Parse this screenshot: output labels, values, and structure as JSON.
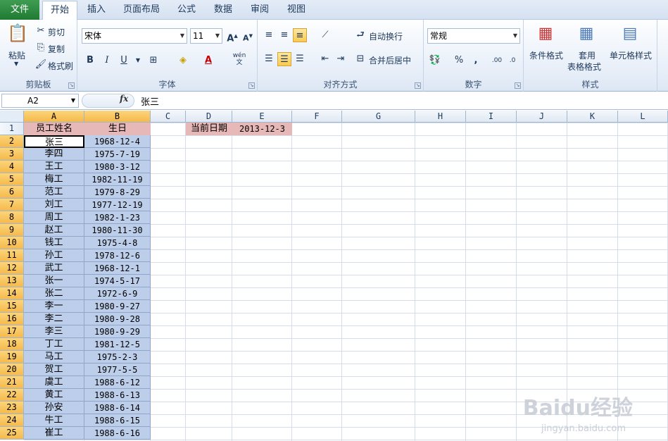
{
  "tabs": [
    "文件",
    "开始",
    "插入",
    "页面布局",
    "公式",
    "数据",
    "审阅",
    "视图"
  ],
  "clipboard": {
    "paste": "粘贴",
    "cut": "剪切",
    "copy": "复制",
    "format_painter": "格式刷",
    "label": "剪贴板"
  },
  "font": {
    "name": "宋体",
    "size": "11",
    "label": "字体",
    "bold": "B",
    "italic": "I",
    "underline": "U",
    "phonetic": "wén"
  },
  "alignment": {
    "wrap": "自动换行",
    "merge": "合并后居中",
    "label": "对齐方式"
  },
  "number": {
    "format": "常规",
    "percent": "%",
    "comma": ",",
    "label": "数字"
  },
  "styles": {
    "conditional": "条件格式",
    "table_line1": "套用",
    "table_line2": "表格格式",
    "cell_styles": "单元格样式",
    "label": "样式"
  },
  "formula_bar": {
    "name_box": "A2",
    "fx": "fx",
    "content": "张三"
  },
  "columns": [
    "A",
    "B",
    "C",
    "D",
    "E",
    "F",
    "G",
    "H",
    "I",
    "J",
    "K",
    "L"
  ],
  "rows": [
    "1",
    "2",
    "3",
    "4",
    "5",
    "6",
    "7",
    "8",
    "9",
    "10",
    "11",
    "12",
    "13",
    "14",
    "15",
    "16",
    "17",
    "18",
    "19",
    "20",
    "21",
    "22",
    "23",
    "24",
    "25"
  ],
  "sheet": {
    "header_name": "员工姓名",
    "header_birth": "生日",
    "current_date_label": "当前日期",
    "current_date_value": "2013-12-3",
    "employees": [
      {
        "name": "张三",
        "birth": "1968-12-4"
      },
      {
        "name": "李四",
        "birth": "1975-7-19"
      },
      {
        "name": "王工",
        "birth": "1980-3-12"
      },
      {
        "name": "梅工",
        "birth": "1982-11-19"
      },
      {
        "name": "范工",
        "birth": "1979-8-29"
      },
      {
        "name": "刘工",
        "birth": "1977-12-19"
      },
      {
        "name": "周工",
        "birth": "1982-1-23"
      },
      {
        "name": "赵工",
        "birth": "1980-11-30"
      },
      {
        "name": "钱工",
        "birth": "1975-4-8"
      },
      {
        "name": "孙工",
        "birth": "1978-12-6"
      },
      {
        "name": "武工",
        "birth": "1968-12-1"
      },
      {
        "name": "张一",
        "birth": "1974-5-17"
      },
      {
        "name": "张二",
        "birth": "1972-6-9"
      },
      {
        "name": "李一",
        "birth": "1980-9-27"
      },
      {
        "name": "李二",
        "birth": "1980-9-28"
      },
      {
        "name": "李三",
        "birth": "1980-9-29"
      },
      {
        "name": "丁工",
        "birth": "1981-12-5"
      },
      {
        "name": "马工",
        "birth": "1975-2-3"
      },
      {
        "name": "贺工",
        "birth": "1977-5-5"
      },
      {
        "name": "虞工",
        "birth": "1988-6-12"
      },
      {
        "name": "黄工",
        "birth": "1988-6-13"
      },
      {
        "name": "孙安",
        "birth": "1988-6-14"
      },
      {
        "name": "牛工",
        "birth": "1988-6-15"
      },
      {
        "name": "崔工",
        "birth": "1988-6-16"
      }
    ]
  },
  "watermark": {
    "main": "Baidu经验",
    "sub": "jingyan.baidu.com"
  },
  "colors": {
    "accent_file": "#1f7a32",
    "selection": "#bccee9",
    "header_pink": "#e6b8b7",
    "header_highlight": "#f6b94a"
  }
}
